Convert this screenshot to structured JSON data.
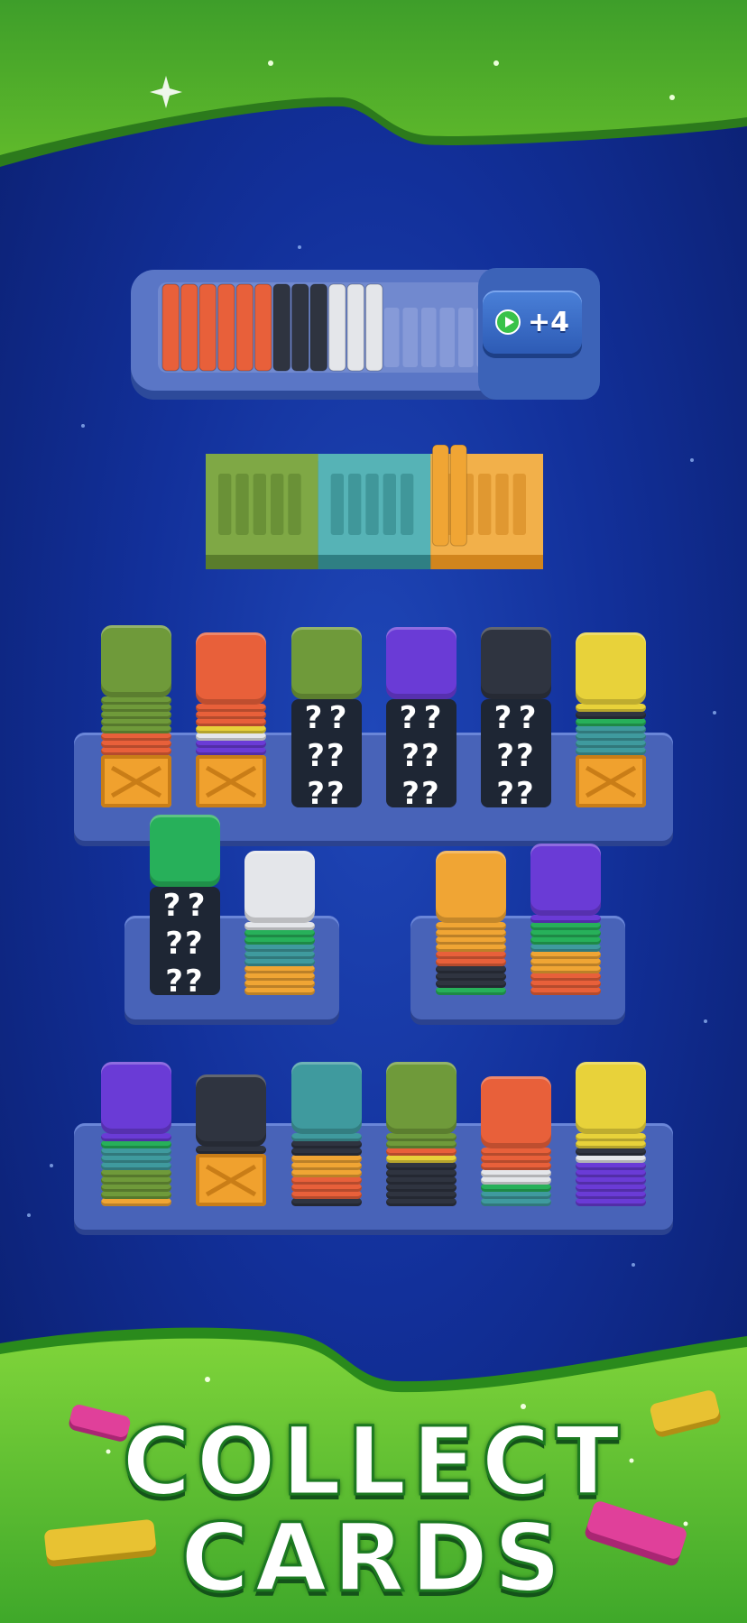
{
  "promo": {
    "headline_line1": "COLLECT",
    "headline_line2": "CARDS"
  },
  "ad_button": {
    "label": "+4",
    "icon": "play-icon"
  },
  "colors": {
    "red": "#e8603a",
    "black": "#2f3440",
    "white": "#e4e6ea",
    "olive": "#6f9a3a",
    "teal": "#3f9a9e",
    "orange": "#f0a534",
    "purple": "#6a3bd6",
    "yellow": "#e8d23a",
    "green": "#27b05a",
    "blue": "#3f7cc8"
  },
  "holding_tray": {
    "slots": 20,
    "cards": [
      "red",
      "red",
      "red",
      "red",
      "red",
      "red",
      "black",
      "black",
      "black",
      "white",
      "white",
      "white"
    ]
  },
  "sort_tray": {
    "sections": [
      "olive",
      "teal",
      "orange"
    ],
    "cards": [
      "orange",
      "orange"
    ]
  },
  "rows": [
    {
      "name": "row-1",
      "columns": [
        {
          "top": "olive",
          "layers": [
            "olive",
            "olive",
            "olive",
            "olive",
            "olive",
            "red",
            "red",
            "red"
          ],
          "base": "crate"
        },
        {
          "top": "red",
          "layers": [
            "red",
            "red",
            "red",
            "yellow",
            "white",
            "purple",
            "purple"
          ],
          "base": "crate"
        },
        {
          "top": "olive",
          "layers": [],
          "base": "mystery"
        },
        {
          "top": "purple",
          "layers": [],
          "base": "mystery"
        },
        {
          "top": "black",
          "layers": [],
          "base": "mystery"
        },
        {
          "top": "yellow",
          "layers": [
            "yellow",
            "black",
            "green",
            "teal",
            "teal",
            "teal",
            "teal"
          ],
          "base": "crate"
        }
      ]
    },
    {
      "name": "row-2",
      "columns": [
        {
          "top": "green",
          "layers": [],
          "base": "mystery"
        },
        {
          "top": "white",
          "layers": [
            "white",
            "green",
            "green",
            "teal",
            "teal",
            "teal",
            "orange",
            "orange",
            "orange",
            "orange"
          ],
          "base": "none"
        },
        {
          "top": "orange",
          "layers": [
            "orange",
            "orange",
            "orange",
            "orange",
            "red",
            "red",
            "black",
            "black",
            "black",
            "green"
          ],
          "base": "none"
        },
        {
          "top": "purple",
          "layers": [
            "purple",
            "green",
            "green",
            "green",
            "teal",
            "orange",
            "orange",
            "orange",
            "red",
            "red",
            "red"
          ],
          "base": "none"
        }
      ]
    },
    {
      "name": "row-3",
      "columns": [
        {
          "top": "purple",
          "layers": [
            "purple",
            "green",
            "teal",
            "teal",
            "teal",
            "olive",
            "olive",
            "olive",
            "olive",
            "orange"
          ],
          "base": "none"
        },
        {
          "top": "black",
          "layers": [
            "black"
          ],
          "base": "crate"
        },
        {
          "top": "teal",
          "layers": [
            "teal",
            "black",
            "black",
            "orange",
            "orange",
            "orange",
            "red",
            "red",
            "red",
            "black"
          ],
          "base": "none"
        },
        {
          "top": "olive",
          "layers": [
            "olive",
            "olive",
            "red",
            "yellow",
            "black",
            "black",
            "black",
            "black",
            "black",
            "black"
          ],
          "base": "none"
        },
        {
          "top": "red",
          "layers": [
            "red",
            "red",
            "red",
            "white",
            "white",
            "green",
            "teal",
            "teal"
          ],
          "base": "none"
        },
        {
          "top": "yellow",
          "layers": [
            "yellow",
            "yellow",
            "black",
            "white",
            "purple",
            "purple",
            "purple",
            "purple",
            "purple",
            "purple"
          ],
          "base": "none"
        }
      ]
    }
  ]
}
